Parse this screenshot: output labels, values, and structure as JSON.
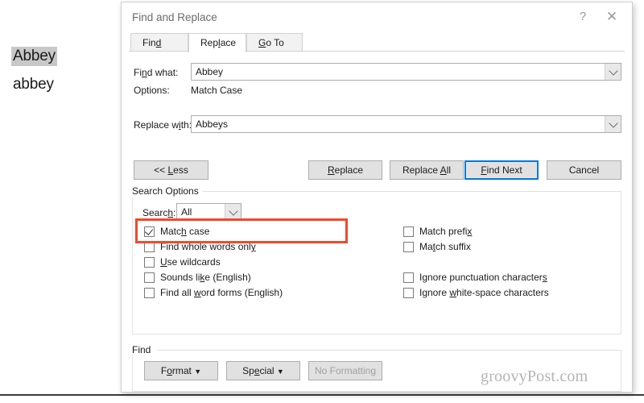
{
  "document": {
    "selected_word": "Abbey",
    "plain_word": "abbey"
  },
  "dialog": {
    "title": "Find and Replace",
    "help_icon": "?",
    "close_icon": "✕",
    "tabs": [
      {
        "label": "Find",
        "active": false
      },
      {
        "label": "Replace",
        "active": true
      },
      {
        "label": "Go To",
        "active": false
      }
    ],
    "fields": {
      "find_label": "Find what:",
      "find_value": "Abbey",
      "options_label": "Options:",
      "options_value": "Match Case",
      "replace_label": "Replace with:",
      "replace_value": "Abbeys"
    },
    "buttons": {
      "less": "<< Less",
      "replace": "Replace",
      "replace_all": "Replace All",
      "find_next": "Find Next",
      "cancel": "Cancel"
    },
    "search_options": {
      "group_label": "Search Options",
      "search_label": "Search:",
      "search_value": "All",
      "left_checkboxes": [
        {
          "label": "Match case",
          "checked": true,
          "highlighted": true
        },
        {
          "label": "Find whole words only",
          "checked": false,
          "highlighted": false
        },
        {
          "label": "Use wildcards",
          "checked": false,
          "highlighted": false
        },
        {
          "label": "Sounds like (English)",
          "checked": false,
          "highlighted": false
        },
        {
          "label": "Find all word forms (English)",
          "checked": false,
          "highlighted": false
        }
      ],
      "right_checkboxes": [
        {
          "label": "Match prefix",
          "checked": false
        },
        {
          "label": "Match suffix",
          "checked": false
        },
        {
          "label": "Ignore punctuation characters",
          "checked": false
        },
        {
          "label": "Ignore white-space characters",
          "checked": false
        }
      ]
    },
    "find_group": {
      "group_label": "Find",
      "format_button": "Format ▾",
      "special_button": "Special ▾",
      "no_formatting_button": "No Formatting"
    }
  },
  "watermark": "groovyPost.com",
  "colors": {
    "focus_blue": "#0078d7",
    "annotation_red": "#ef4a2e",
    "selection_gray": "#c8c8c8",
    "button_face": "#e1e1e1"
  }
}
